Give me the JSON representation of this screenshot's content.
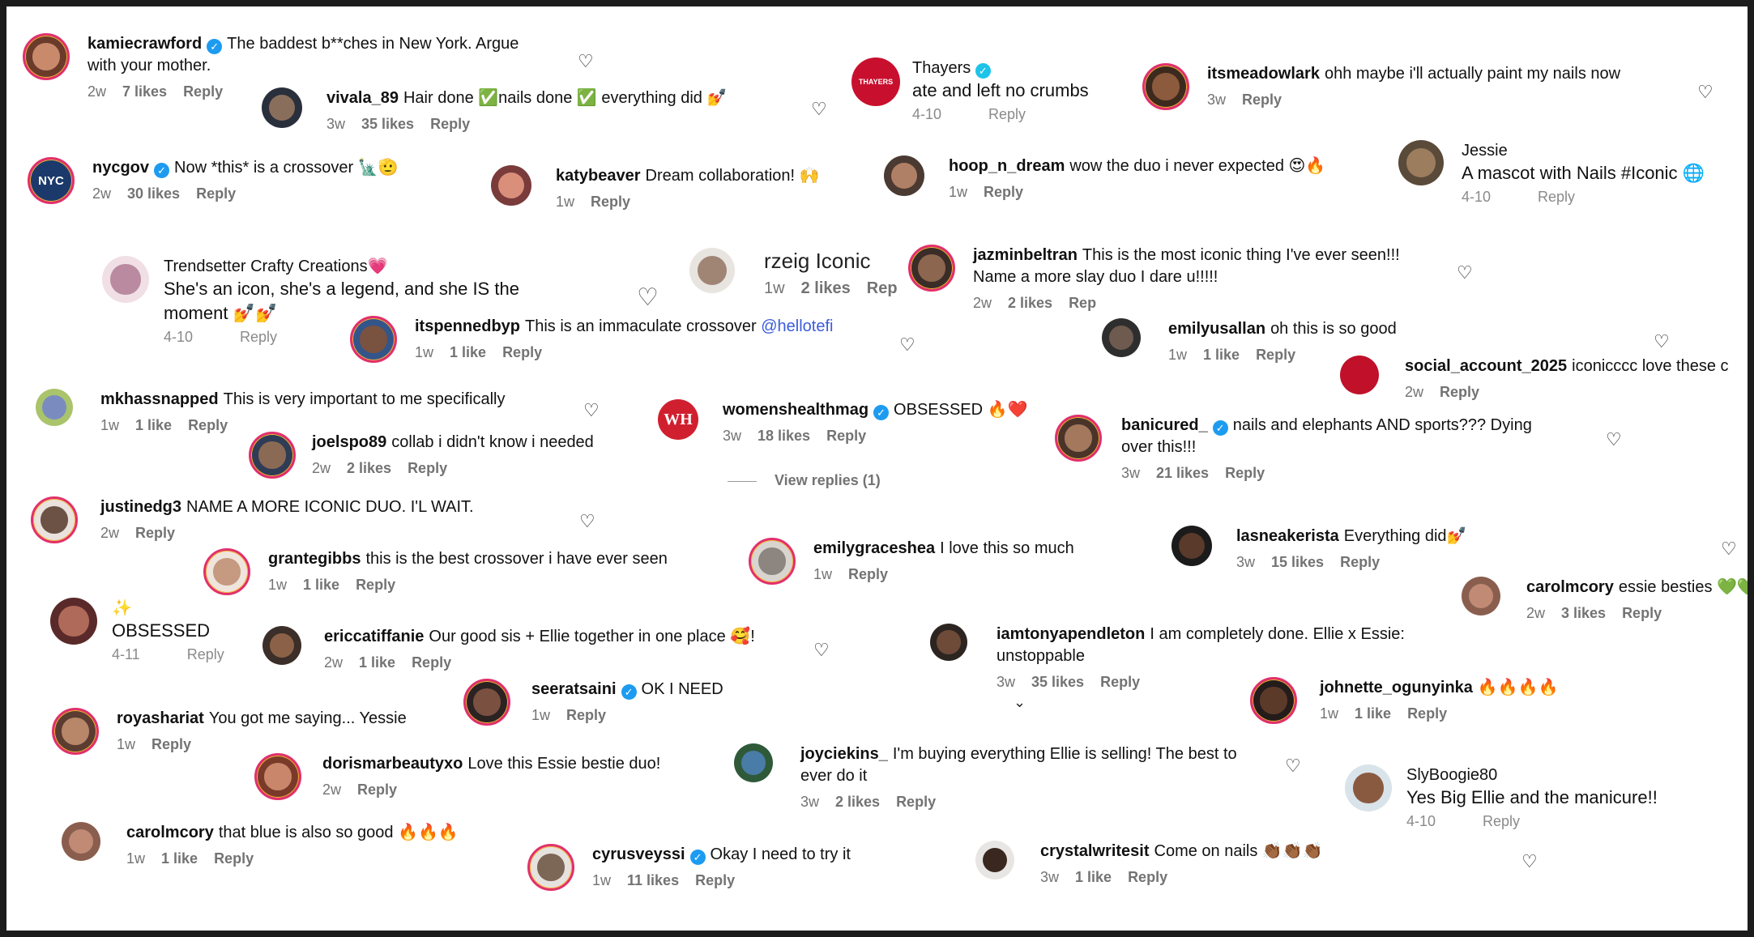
{
  "comments": [
    {
      "username": "kamiecrawford",
      "verified": true,
      "text": "The baddest b**ches in New York. Argue",
      "text2": "with your mother.",
      "age": "2w",
      "likes": "7 likes",
      "reply": "Reply"
    },
    {
      "username": "vivala_89",
      "verified": false,
      "text": "Hair done ✅nails done ✅ everything did 💅",
      "age": "3w",
      "likes": "35 likes",
      "reply": "Reply"
    },
    {
      "username": "itsmeadowlark",
      "verified": false,
      "text": "ohh maybe i'll actually paint my nails now",
      "age": "3w",
      "likes": "",
      "reply": "Reply"
    },
    {
      "username": "nycgov",
      "verified": true,
      "text": "Now *this* is a crossover 🗽🫡",
      "age": "2w",
      "likes": "30 likes",
      "reply": "Reply"
    },
    {
      "username": "katybeaver",
      "verified": false,
      "text": "Dream collaboration! 🙌",
      "age": "1w",
      "likes": "",
      "reply": "Reply"
    },
    {
      "username": "hoop_n_dream",
      "verified": false,
      "text": "wow the duo i never expected 😍🔥",
      "age": "1w",
      "likes": "",
      "reply": "Reply"
    },
    {
      "username": "jazminbeltran",
      "verified": false,
      "text": "This is the most iconic thing I've ever seen!!!",
      "text2": "Name a more slay duo I dare u!!!!!",
      "age": "2w",
      "likes": "2 likes",
      "reply": "Rep"
    },
    {
      "username": "itspennedbyp",
      "verified": false,
      "text": "This is an immaculate crossover",
      "mention": "@hellotefi",
      "age": "1w",
      "likes": "1 like",
      "reply": "Reply"
    },
    {
      "username": "emilyusallan",
      "verified": false,
      "text": "oh this is so good",
      "age": "1w",
      "likes": "1 like",
      "reply": "Reply"
    },
    {
      "username": "social_account_2025",
      "verified": false,
      "text": "iconicccc love these c",
      "age": "2w",
      "likes": "",
      "reply": "Reply"
    },
    {
      "username": "mkhassnapped",
      "verified": false,
      "text": "This is very important to me specifically",
      "age": "1w",
      "likes": "1 like",
      "reply": "Reply"
    },
    {
      "username": "womenshealthmag",
      "verified": true,
      "text": "OBSESSED 🔥❤️",
      "age": "3w",
      "likes": "18 likes",
      "reply": "Reply",
      "view_replies": "View replies (1)"
    },
    {
      "username": "banicured_",
      "verified": true,
      "text": "nails and elephants AND sports??? Dying",
      "text2": "over this!!!",
      "age": "3w",
      "likes": "21 likes",
      "reply": "Reply"
    },
    {
      "username": "joelspo89",
      "verified": false,
      "text": "collab i didn't know i needed",
      "age": "2w",
      "likes": "2 likes",
      "reply": "Reply"
    },
    {
      "username": "justinedg3",
      "verified": false,
      "text": "NAME A MORE ICONIC DUO. I'L WAIT.",
      "age": "2w",
      "likes": "",
      "reply": "Reply"
    },
    {
      "username": "lasneakerista",
      "verified": false,
      "text": "Everything did💅",
      "age": "3w",
      "likes": "15 likes",
      "reply": "Reply"
    },
    {
      "username": "grantegibbs",
      "verified": false,
      "text": "this is the best crossover i have ever seen",
      "age": "1w",
      "likes": "1 like",
      "reply": "Reply"
    },
    {
      "username": "emilygraceshea",
      "verified": false,
      "text": "I love this so much",
      "age": "1w",
      "likes": "",
      "reply": "Reply"
    },
    {
      "username": "carolmcory",
      "verified": false,
      "text": "essie besties 💚💚",
      "age": "2w",
      "likes": "3 likes",
      "reply": "Reply"
    },
    {
      "username": "ericcatiffanie",
      "verified": false,
      "text": "Our good sis + Ellie together in one place 🥰!",
      "age": "2w",
      "likes": "1 like",
      "reply": "Reply"
    },
    {
      "username": "iamtonyapendleton",
      "verified": false,
      "text": "I am completely done. Ellie x Essie:",
      "text2": "unstoppable",
      "age": "3w",
      "likes": "35 likes",
      "reply": "Reply"
    },
    {
      "username": "seeratsaini",
      "verified": true,
      "text": "OK I NEED",
      "age": "1w",
      "likes": "",
      "reply": "Reply"
    },
    {
      "username": "johnette_ogunyinka",
      "verified": false,
      "text": "🔥🔥🔥🔥",
      "age": "1w",
      "likes": "1 like",
      "reply": "Reply"
    },
    {
      "username": "royashariat",
      "verified": false,
      "text": "You got me saying... Yessie",
      "age": "1w",
      "likes": "",
      "reply": "Reply"
    },
    {
      "username": "joyciekins_",
      "verified": false,
      "text": "I'm buying everything Ellie is selling! The best to",
      "text2": "ever do it",
      "age": "3w",
      "likes": "2 likes",
      "reply": "Reply"
    },
    {
      "username": "dorismarbeautyxo",
      "verified": false,
      "text": "Love this Essie bestie duo!",
      "age": "2w",
      "likes": "",
      "reply": "Reply"
    },
    {
      "username": "carolmcory",
      "verified": false,
      "text": "that blue is also so good 🔥🔥🔥",
      "age": "1w",
      "likes": "1 like",
      "reply": "Reply"
    },
    {
      "username": "cyrusveyssi",
      "verified": true,
      "text": "Okay I need to try it",
      "age": "1w",
      "likes": "11 likes",
      "reply": "Reply"
    },
    {
      "username": "crystalwritesit",
      "verified": false,
      "text": "Come on nails 👏🏾👏🏾👏🏾",
      "age": "3w",
      "likes": "1 like",
      "reply": "Reply"
    }
  ],
  "fb_comments": [
    {
      "name": "Thayers",
      "avatar_text": "THAYERS",
      "text": "ate and left no crumbs",
      "date": "4-10",
      "reply": "Reply"
    },
    {
      "name": "Jessie",
      "text": "A mascot with Nails #Iconic 🌐",
      "date": "4-10",
      "reply": "Reply"
    },
    {
      "name": "Trendsetter Crafty Creations💗",
      "text": "She's an icon, she's a legend, and she IS the",
      "text2": "moment 💅💅",
      "date": "4-10",
      "reply": "Reply"
    },
    {
      "name": "✨",
      "text": "OBSESSED",
      "date": "4-11",
      "reply": "Reply"
    },
    {
      "name": "SlyBoogie80",
      "text": "Yes Big Ellie and the manicure!!",
      "date": "4-10",
      "reply": "Reply"
    }
  ],
  "rzeig": {
    "name": "rzeig Iconic",
    "age": "1w",
    "likes": "2 likes",
    "reply": "Rep"
  },
  "icons": {
    "heart": "heart-outline-icon",
    "verified": "verified-badge-icon",
    "chevron": "chevron-down-icon"
  },
  "colors": {
    "verified": "#1d9bf0",
    "meta": "#737373",
    "background": "#ffffff",
    "frame": "#1c1c1c",
    "ring": "#e1306c"
  }
}
